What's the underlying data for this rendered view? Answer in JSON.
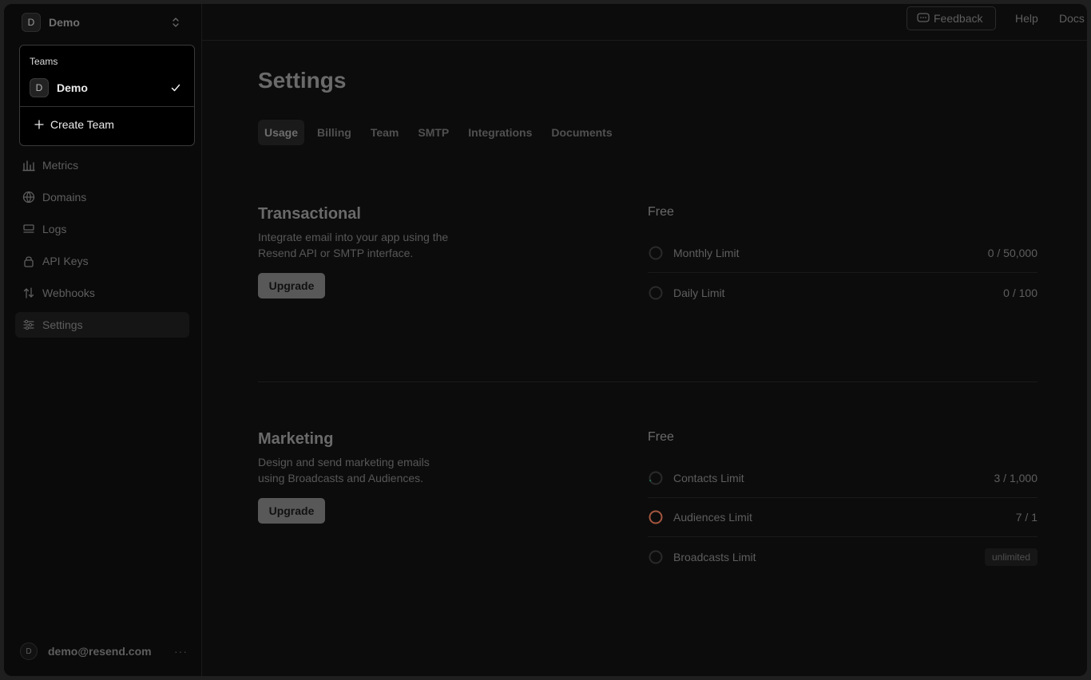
{
  "team_switcher": {
    "initial": "D",
    "name": "Demo"
  },
  "dropdown": {
    "section_label": "Teams",
    "teams": [
      {
        "initial": "D",
        "name": "Demo",
        "selected": true
      }
    ],
    "create_label": "Create Team"
  },
  "sidebar": {
    "items": [
      {
        "label": "Metrics",
        "icon": "bar-chart-icon"
      },
      {
        "label": "Domains",
        "icon": "globe-icon"
      },
      {
        "label": "Logs",
        "icon": "list-icon"
      },
      {
        "label": "API Keys",
        "icon": "lock-icon"
      },
      {
        "label": "Webhooks",
        "icon": "webhook-icon"
      },
      {
        "label": "Settings",
        "icon": "sliders-icon",
        "active": true
      }
    ]
  },
  "user": {
    "initial": "D",
    "email": "demo@resend.com",
    "menu": "···"
  },
  "topbar": {
    "feedback": "Feedback",
    "help": "Help",
    "docs": "Docs"
  },
  "page": {
    "title": "Settings",
    "tabs": [
      "Usage",
      "Billing",
      "Team",
      "SMTP",
      "Integrations",
      "Documents"
    ],
    "active_tab": "Usage"
  },
  "transactional": {
    "title": "Transactional",
    "description": "Integrate email into your app using the Resend API or SMTP interface.",
    "upgrade": "Upgrade",
    "plan": "Free",
    "limits": [
      {
        "name": "Monthly Limit",
        "value": "0 / 50,000",
        "used": 0,
        "max": 50000
      },
      {
        "name": "Daily Limit",
        "value": "0 / 100",
        "used": 0,
        "max": 100
      }
    ]
  },
  "marketing": {
    "title": "Marketing",
    "description": "Design and send marketing emails using Broadcasts and Audiences.",
    "upgrade": "Upgrade",
    "plan": "Free",
    "limits": [
      {
        "name": "Contacts Limit",
        "value": "3 / 1,000",
        "used": 3,
        "max": 1000
      },
      {
        "name": "Audiences Limit",
        "value": "7 / 1",
        "used": 7,
        "max": 1
      },
      {
        "name": "Broadcasts Limit",
        "badge": "unlimited"
      }
    ]
  },
  "colors": {
    "ring_track": "#2a2a2a",
    "ring_progress": "#1f7a5c",
    "ring_over": "#a3563f"
  }
}
